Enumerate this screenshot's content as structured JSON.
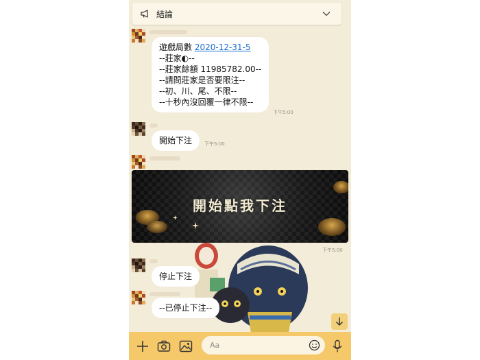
{
  "announcement": {
    "label": "結論"
  },
  "messages": [
    {
      "type": "text",
      "lines": [
        "遊戲局數 ",
        "--莊家◐--",
        "--莊家餘額 11985782.00--",
        "--請問莊家是否要限注--",
        "--初、川、尾、不限--",
        "--十秒內沒回覆一律不限--"
      ],
      "link": "2020-12-31-5",
      "time": "下午5:00"
    },
    {
      "type": "text",
      "text": "開始下注",
      "time": "下午5:00"
    },
    {
      "type": "image",
      "text": "開始點我下注",
      "time": "下午5:00"
    },
    {
      "type": "text",
      "text": "停止下注"
    },
    {
      "type": "text",
      "text": "--已停止下注--"
    }
  ],
  "input": {
    "placeholder": "Aa"
  },
  "colors": {
    "chat_bg": "#f3ecd9",
    "input_bar": "#f5c96a",
    "link": "#1a6fd1"
  }
}
